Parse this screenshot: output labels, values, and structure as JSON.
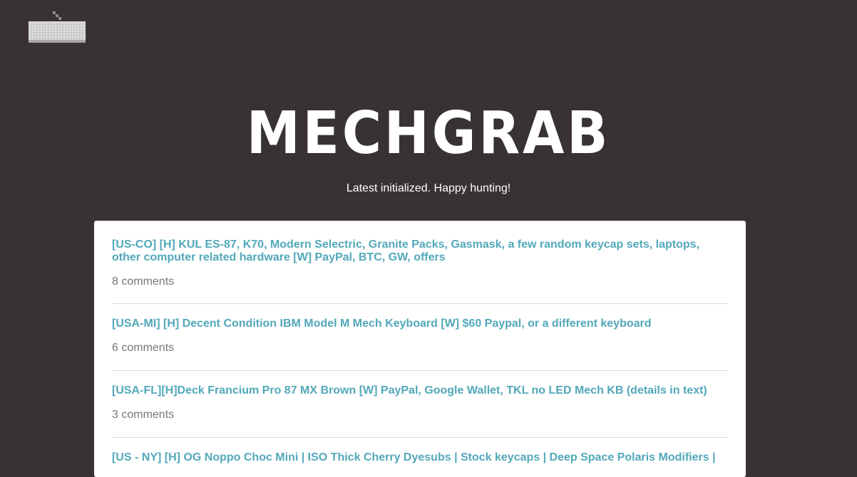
{
  "header": {
    "logo_icon": "keyboard-icon",
    "brand": "MECHGRAB",
    "status": "Latest initialized. Happy hunting!"
  },
  "posts": [
    {
      "title": "[US-CO] [H] KUL ES-87, K70, Modern Selectric, Granite Packs, Gasmask, a few random keycap sets, laptops, other computer related hardware [W] PayPal, BTC, GW, offers",
      "comments": "8 comments"
    },
    {
      "title": "[USA-MI] [H] Decent Condition IBM Model M Mech Keyboard [W] $60 Paypal, or a different keyboard",
      "comments": "6 comments"
    },
    {
      "title": "[USA-FL][H]Deck Francium Pro 87 MX Brown [W] PayPal, Google Wallet, TKL no LED Mech KB (details in text)",
      "comments": "3 comments"
    },
    {
      "title": "[US - NY] [H] OG Noppo Choc Mini | ISO Thick Cherry Dyesubs | Stock keycaps | Deep Space Polaris Modifiers |"
    }
  ],
  "colors": {
    "background": "#383332",
    "card": "#ffffff",
    "link": "#52a8b9",
    "muted": "#777777",
    "divider": "#dddddd"
  }
}
